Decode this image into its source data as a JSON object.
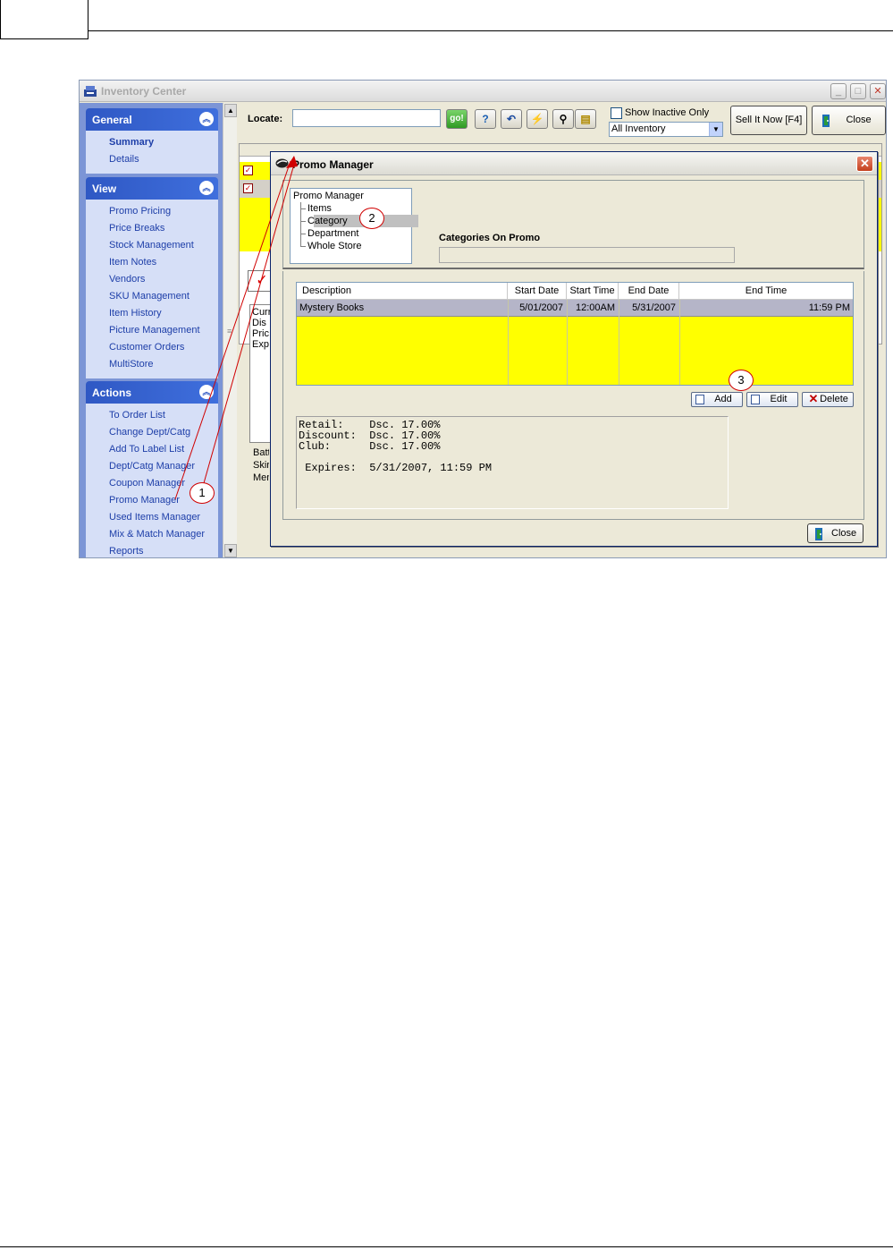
{
  "inventory_center": {
    "title": "Inventory Center",
    "toolbar": {
      "locate_label": "Locate:",
      "go_label": "go!",
      "help_label": "?",
      "show_inactive_label": "Show Inactive Only",
      "inventory_filter": "All Inventory",
      "sell_it_now_label": "Sell It Now [F4]",
      "close_label": "Close"
    },
    "nav": {
      "general": {
        "title": "General",
        "items": [
          "Summary",
          "Details"
        ]
      },
      "view": {
        "title": "View",
        "items": [
          "Promo Pricing",
          "Price Breaks",
          "Stock Management",
          "Item Notes",
          "Vendors",
          "SKU Management",
          "Item History",
          "Picture Management",
          "Customer Orders",
          "MultiStore"
        ]
      },
      "actions": {
        "title": "Actions",
        "items": [
          "To Order List",
          "Change Dept/Catg",
          "Add To Label List",
          "Dept/Catg Manager",
          "Coupon Manager",
          "Promo Manager",
          "Used Items Manager",
          "Mix & Match Manager",
          "Reports"
        ]
      }
    },
    "background_fragments": [
      "Curr",
      "Dis",
      "Pric",
      "Exp",
      "Batt",
      "Skir",
      "Men"
    ]
  },
  "promo_manager": {
    "title": "Promo Manager",
    "tree": {
      "root": "Promo Manager",
      "children": [
        "Items",
        "Category",
        "Department",
        "Whole Store"
      ],
      "selected": "Category"
    },
    "section_label": "Categories On Promo",
    "table": {
      "columns": [
        "Description",
        "Start Date",
        "Start Time",
        "End Date",
        "End Time"
      ],
      "rows": [
        {
          "description": "Mystery Books",
          "start_date": "5/01/2007",
          "start_time": "12:00AM",
          "end_date": "5/31/2007",
          "end_time": "11:59 PM"
        }
      ]
    },
    "buttons": {
      "add": "Add",
      "edit": "Edit",
      "delete": "Delete",
      "close": "Close"
    },
    "details": {
      "retail": "Retail:    Dsc. 17.00%",
      "discount": "Discount:  Dsc. 17.00%",
      "club": "Club:      Dsc. 17.00%",
      "expires": " Expires:  5/31/2007, 11:59 PM"
    }
  },
  "callouts": [
    "1",
    "2",
    "3"
  ],
  "colors": {
    "highlight_yellow": "#ffff00",
    "nav_header_blue": "#2f58c4",
    "nav_link_blue": "#1d3ea8",
    "annotation_red": "#d00000"
  }
}
